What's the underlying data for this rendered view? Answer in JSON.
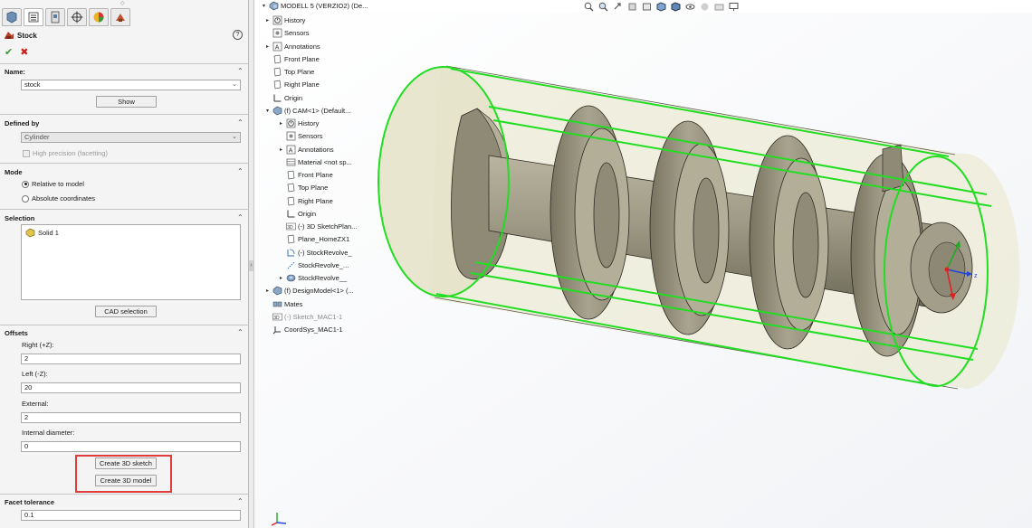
{
  "panel": {
    "tabs": [
      {
        "icon": "feature-manager-icon",
        "active": false
      },
      {
        "icon": "property-manager-icon",
        "active": true
      },
      {
        "icon": "configuration-manager-icon",
        "active": false
      },
      {
        "icon": "dimxpert-icon",
        "active": false
      },
      {
        "icon": "display-manager-icon",
        "active": false
      },
      {
        "icon": "cam-manager-icon",
        "active": false
      }
    ],
    "title": "Stock",
    "help": "?",
    "ok": "✔",
    "cancel": "✖",
    "name_group": {
      "title": "Name:",
      "value": "stock",
      "show_button": "Show"
    },
    "defined_by_group": {
      "title": "Defined by",
      "value": "Cylinder",
      "high_precision": "High precision (facetting)"
    },
    "mode_group": {
      "title": "Mode",
      "option1": "Relative to model",
      "option2": "Absolute coordinates"
    },
    "selection_group": {
      "title": "Selection",
      "item": "Solid 1",
      "cad_button": "CAD selection"
    },
    "offsets_group": {
      "title": "Offsets",
      "right_label": "Right (+Z):",
      "right_value": "2",
      "left_label": "Left (-Z):",
      "left_value": "20",
      "external_label": "External:",
      "external_value": "2",
      "internal_label": "Internal diameter:",
      "internal_value": "0",
      "create_sketch": "Create 3D sketch",
      "create_model": "Create 3D model"
    },
    "facet_group": {
      "title": "Facet  tolerance",
      "value": "0.1"
    }
  },
  "tree": {
    "root": "MODELL 5 (VERZIO2)  (De...",
    "items": [
      {
        "label": "History",
        "icon": "history-icon",
        "level": 1,
        "expand": "▸"
      },
      {
        "label": "Sensors",
        "icon": "sensors-icon",
        "level": 1,
        "expand": ""
      },
      {
        "label": "Annotations",
        "icon": "annotations-icon",
        "level": 1,
        "expand": "▸"
      },
      {
        "label": "Front Plane",
        "icon": "plane-icon",
        "level": 1,
        "expand": ""
      },
      {
        "label": "Top Plane",
        "icon": "plane-icon",
        "level": 1,
        "expand": ""
      },
      {
        "label": "Right Plane",
        "icon": "plane-icon",
        "level": 1,
        "expand": ""
      },
      {
        "label": "Origin",
        "icon": "origin-icon",
        "level": 1,
        "expand": ""
      },
      {
        "label": "(f) CAM<1> (Default...",
        "icon": "part-icon",
        "level": 1,
        "expand": "▾"
      },
      {
        "label": "History",
        "icon": "history-icon",
        "level": 2,
        "expand": "▸"
      },
      {
        "label": "Sensors",
        "icon": "sensors-icon",
        "level": 2,
        "expand": ""
      },
      {
        "label": "Annotations",
        "icon": "annotations-icon",
        "level": 2,
        "expand": "▸"
      },
      {
        "label": "Material <not sp...",
        "icon": "material-icon",
        "level": 2,
        "expand": ""
      },
      {
        "label": "Front Plane",
        "icon": "plane-icon",
        "level": 2,
        "expand": ""
      },
      {
        "label": "Top Plane",
        "icon": "plane-icon",
        "level": 2,
        "expand": ""
      },
      {
        "label": "Right Plane",
        "icon": "plane-icon",
        "level": 2,
        "expand": ""
      },
      {
        "label": "Origin",
        "icon": "origin-icon",
        "level": 2,
        "expand": ""
      },
      {
        "label": "(-) 3D SketchPlan...",
        "icon": "sketch3d-icon",
        "level": 2,
        "expand": ""
      },
      {
        "label": "Plane_HomeZX1",
        "icon": "plane-icon",
        "level": 2,
        "expand": ""
      },
      {
        "label": "(-) StockRevolve_",
        "icon": "sketch-icon",
        "level": 2,
        "expand": ""
      },
      {
        "label": "StockRevolve_...",
        "icon": "sketch-dots-icon",
        "level": 2,
        "expand": ""
      },
      {
        "label": "StockRevolve__",
        "icon": "revolve-icon",
        "level": 2,
        "expand": "▸"
      },
      {
        "label": "(f) DesignModel<1> (...",
        "icon": "part-icon",
        "level": 1,
        "expand": "▸"
      },
      {
        "label": "Mates",
        "icon": "mates-icon",
        "level": 1,
        "expand": ""
      },
      {
        "label": "(-) Sketch_MAC1-1",
        "icon": "sketch3d-icon",
        "level": 1,
        "expand": "",
        "grey": true
      },
      {
        "label": "CoordSys_MAC1-1",
        "icon": "coordsys-icon",
        "level": 1,
        "expand": ""
      }
    ]
  },
  "hud": [
    "zoom-to-fit-icon",
    "zoom-area-icon",
    "previous-view-icon",
    "section-view-icon",
    "dynamic-annotation-icon",
    "view-orientation-icon",
    "display-style-icon",
    "hide-show-icon",
    "edit-appearance-icon",
    "apply-scene-icon",
    "view-settings-icon"
  ],
  "viewport": {
    "triad_label": "z"
  },
  "colors": {
    "stock_outline": "#22dd22",
    "model_fill": "#8e8a76",
    "stock_fill": "#ecebd6"
  }
}
